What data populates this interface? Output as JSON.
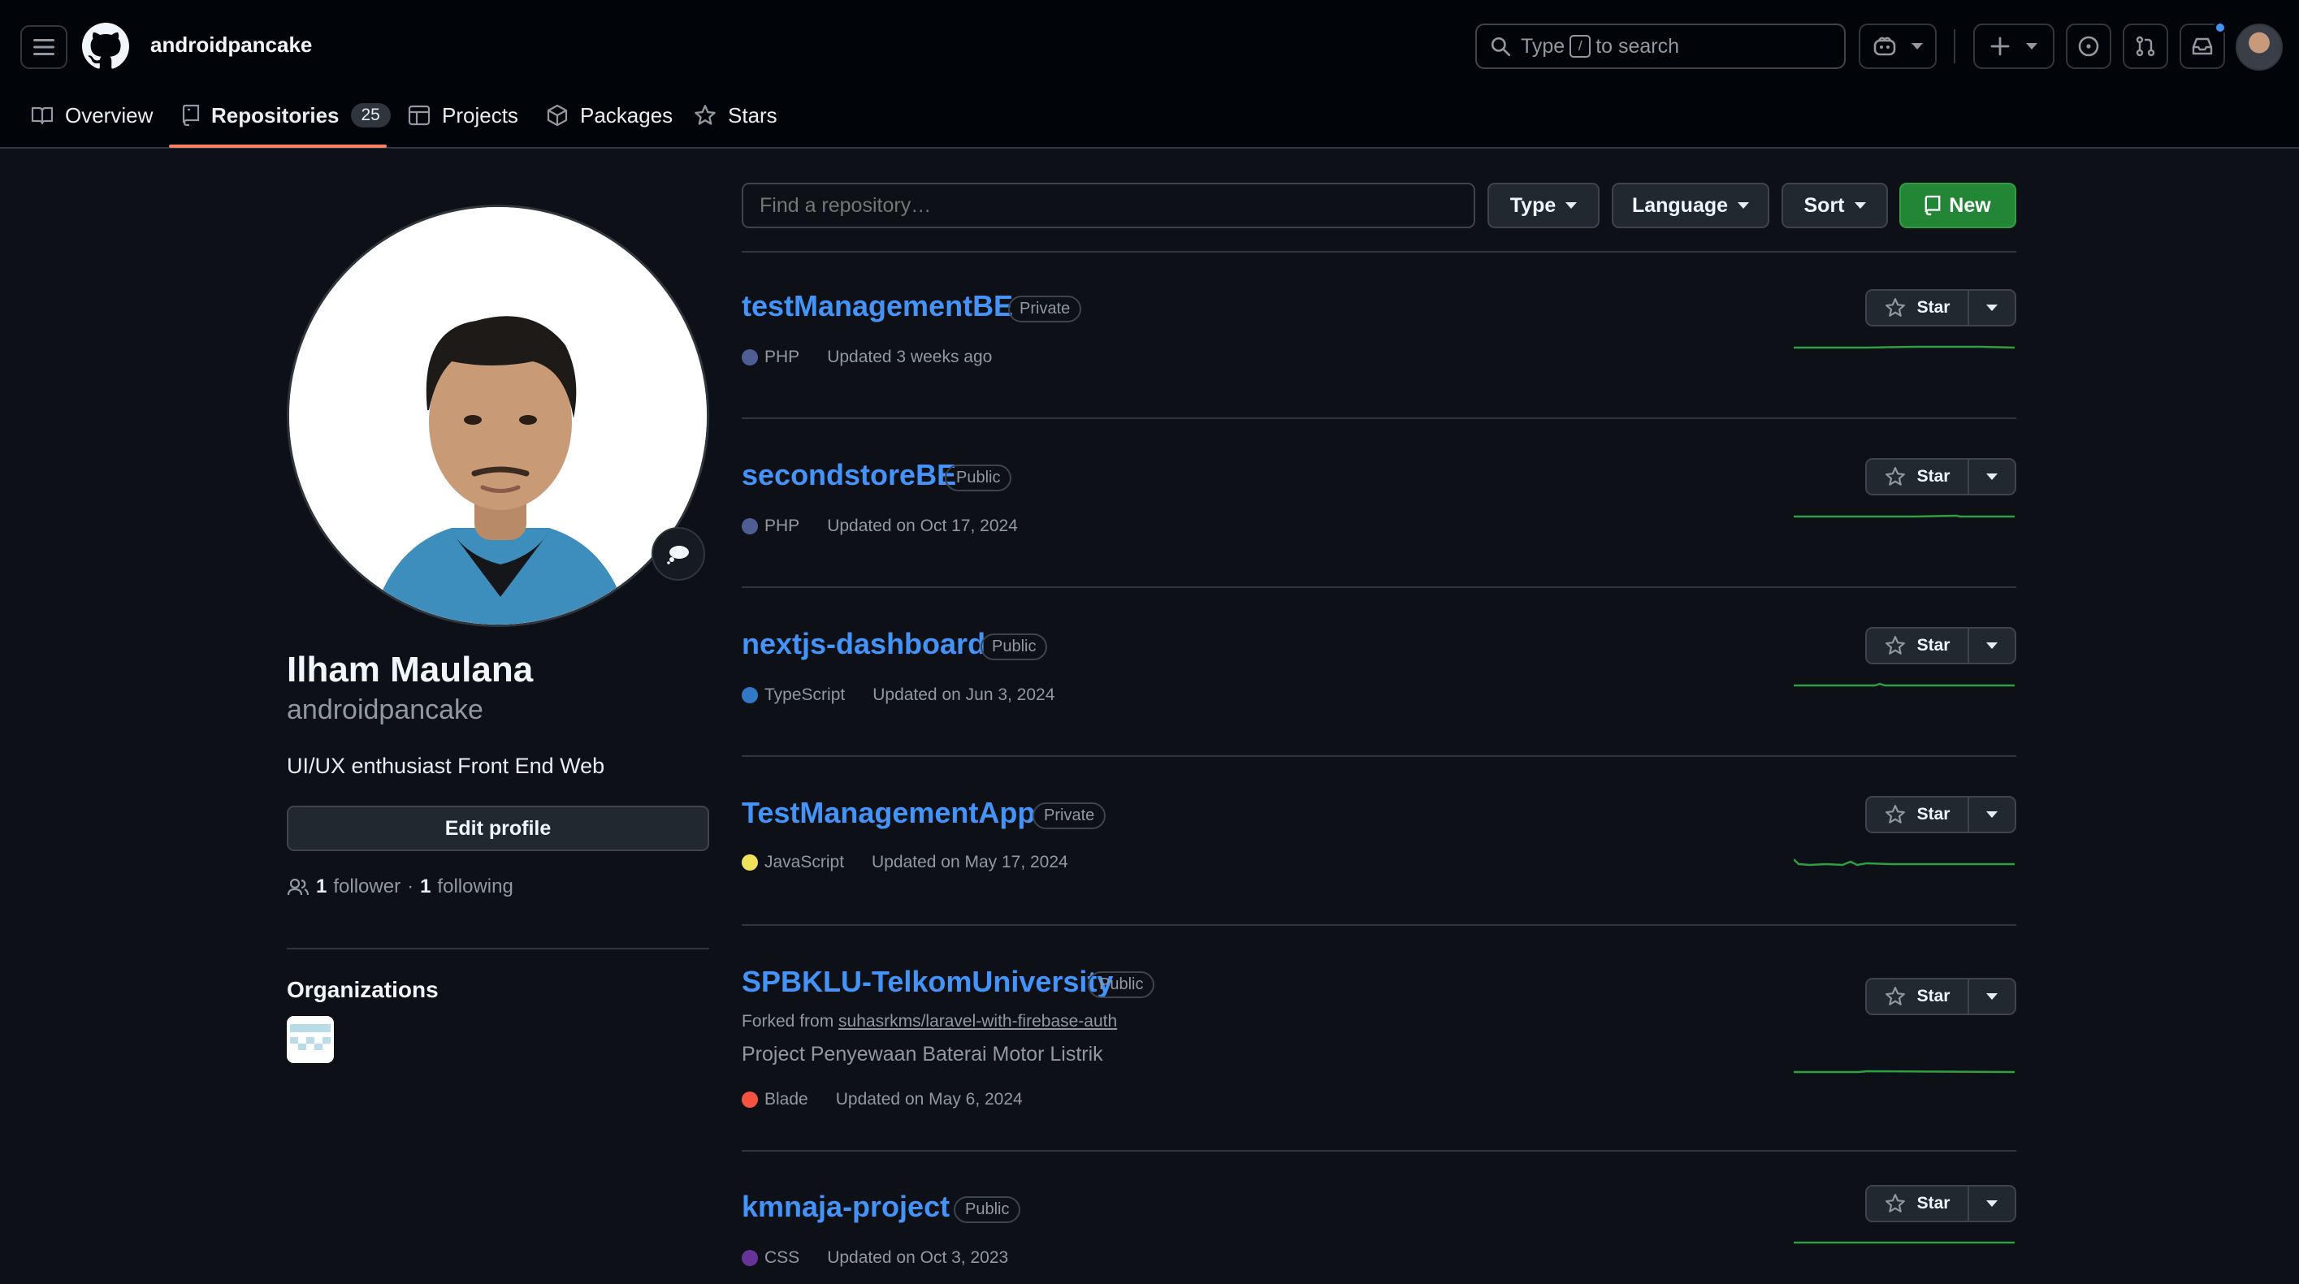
{
  "header": {
    "username": "androidpancake",
    "search_prefix": "Type",
    "search_key": "/",
    "search_suffix": "to search"
  },
  "tabs": [
    {
      "label": "Overview"
    },
    {
      "label": "Repositories",
      "count": "25"
    },
    {
      "label": "Projects"
    },
    {
      "label": "Packages"
    },
    {
      "label": "Stars"
    }
  ],
  "profile": {
    "full_name": "Ilham Maulana",
    "login": "androidpancake",
    "bio": "UI/UX enthusiast Front End Web",
    "edit_label": "Edit profile",
    "followers_count": "1",
    "followers_label": "follower",
    "separator": "·",
    "following_count": "1",
    "following_label": "following",
    "organizations_title": "Organizations"
  },
  "filters": {
    "search_placeholder": "Find a repository…",
    "type_label": "Type",
    "language_label": "Language",
    "sort_label": "Sort",
    "new_label": "New"
  },
  "colors": {
    "accent_link": "#4493f8",
    "new_button": "#238636",
    "tab_underline": "#f78166",
    "sparkline": "#2ea043"
  },
  "star_label": "Star",
  "repos": [
    {
      "name": "testManagementBE",
      "visibility": "Private",
      "language": "PHP",
      "language_color": "#4F5D95",
      "updated": "Updated 3 weeks ago"
    },
    {
      "name": "secondstoreBE",
      "visibility": "Public",
      "language": "PHP",
      "language_color": "#4F5D95",
      "updated": "Updated on Oct 17, 2024"
    },
    {
      "name": "nextjs-dashboard",
      "visibility": "Public",
      "language": "TypeScript",
      "language_color": "#3178c6",
      "updated": "Updated on Jun 3, 2024"
    },
    {
      "name": "TestManagementApp",
      "visibility": "Private",
      "language": "JavaScript",
      "language_color": "#f1e05a",
      "updated": "Updated on May 17, 2024"
    },
    {
      "name": "SPBKLU-TelkomUniversity",
      "visibility": "Public",
      "forked_prefix": "Forked from",
      "forked_from": "suhasrkms/laravel-with-firebase-auth",
      "description": "Project Penyewaan Baterai Motor Listrik",
      "language": "Blade",
      "language_color": "#f7523f",
      "updated": "Updated on May 6, 2024"
    },
    {
      "name": "kmnaja-project",
      "visibility": "Public",
      "language": "CSS",
      "language_color": "#663399",
      "updated": "Updated on Oct 3, 2023"
    }
  ]
}
